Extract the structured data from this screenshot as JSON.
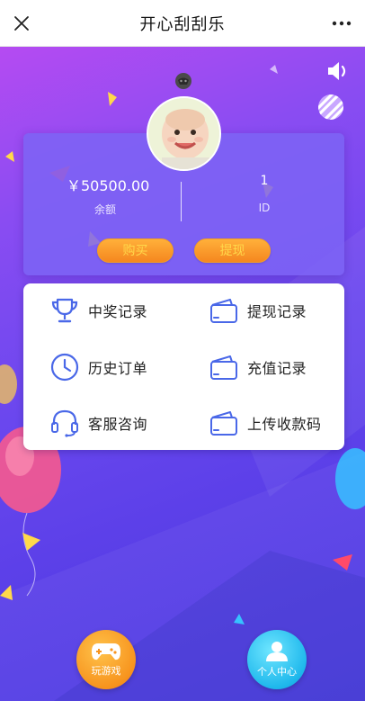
{
  "nav": {
    "title": "开心刮刮乐",
    "close_icon": "close-icon",
    "more_icon": "more-dots-icon"
  },
  "profile": {
    "balance": "￥50500.00",
    "balance_label": "余额",
    "id_value": "1",
    "id_label": "ID",
    "buy_label": "购买",
    "withdraw_label": "提现"
  },
  "menu": {
    "items": [
      {
        "label": "中奖记录",
        "icon": "trophy-icon"
      },
      {
        "label": "提现记录",
        "icon": "wallet-icon"
      },
      {
        "label": "历史订单",
        "icon": "clock-icon"
      },
      {
        "label": "充值记录",
        "icon": "wallet-icon"
      },
      {
        "label": "客服咨询",
        "icon": "headset-icon"
      },
      {
        "label": "上传收款码",
        "icon": "wallet-icon"
      }
    ]
  },
  "tabs": {
    "game_label": "玩游戏",
    "me_label": "个人中心"
  },
  "colors": {
    "accent_orange": "#f7941e",
    "button_text": "#ffd84a",
    "icon_blue": "#4a68e8",
    "tab_blue": "#1fb8ec",
    "bg_purple": "#6a47ee"
  }
}
